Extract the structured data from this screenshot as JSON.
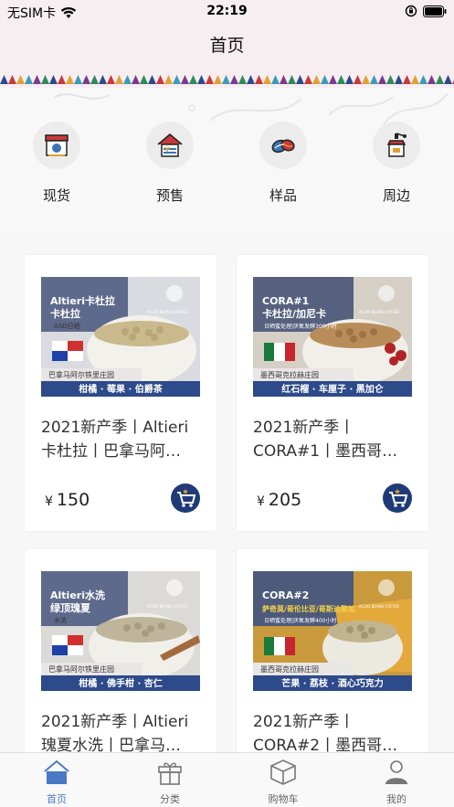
{
  "status": {
    "carrier": "无SIM卡",
    "time": "22:19"
  },
  "nav": {
    "title": "首页"
  },
  "categories": [
    {
      "label": "现货",
      "icon": "jar-icon"
    },
    {
      "label": "预售",
      "icon": "house-icon"
    },
    {
      "label": "样品",
      "icon": "coffee-bean-icon"
    },
    {
      "label": "周边",
      "icon": "grinder-icon"
    }
  ],
  "products": [
    {
      "name": "2021新产季丨Altieri卡杜拉丨巴拿马阿…",
      "price": "150",
      "currency": "¥",
      "img": {
        "title1": "Altieri卡杜拉",
        "title2": "卡杜拉",
        "tag": "ASD日晒",
        "origin": "巴拿马阿尔铁里庄园",
        "notes": "柑橘 · 莓果 · 伯爵茶",
        "flag": "panama"
      }
    },
    {
      "name": "2021新产季丨CORA#1丨墨西哥…",
      "price": "205",
      "currency": "¥",
      "img": {
        "title1": "CORA#1",
        "title2": "卡杜拉/加尼卡",
        "tag": "日晒蜜处理|厌氧发酵300小时",
        "origin": "墨西哥克拉赫庄园",
        "notes": "红石榴 · 车厘子 · 黑加仑",
        "flag": "mexico"
      }
    },
    {
      "name": "2021新产季丨Altieri瑰夏水洗丨巴拿马…",
      "img": {
        "title1": "Altieri水洗",
        "title2": "绿顶瑰夏",
        "tag": "水洗",
        "origin": "巴拿马阿尔铁里庄园",
        "notes": "柑橘 · 佛手柑 · 杏仁",
        "flag": "panama"
      }
    },
    {
      "name": "2021新产季丨CORA#2丨墨西哥…",
      "img": {
        "title1": "CORA#2",
        "title2": "萨奇莫/哥伦比亚/哥斯达黎加",
        "tag": "日晒蜜处理|厌氧发酵400小时",
        "origin": "墨西哥克拉赫庄园",
        "notes": "芒果 · 荔枝 · 酒心巧克力",
        "flag": "mexico"
      }
    }
  ],
  "brand": {
    "logo_text": "ACCIO BEANS COFFEE"
  },
  "tabs": [
    {
      "label": "首页",
      "icon": "home-icon",
      "active": true
    },
    {
      "label": "分类",
      "icon": "gift-box-icon",
      "active": false
    },
    {
      "label": "购物车",
      "icon": "package-icon",
      "active": false
    },
    {
      "label": "我的",
      "icon": "user-icon",
      "active": false
    }
  ],
  "colors": {
    "accent": "#4a78c6",
    "nav_bg": "#f7eef1",
    "notes_bar": "#2d4a8a"
  }
}
